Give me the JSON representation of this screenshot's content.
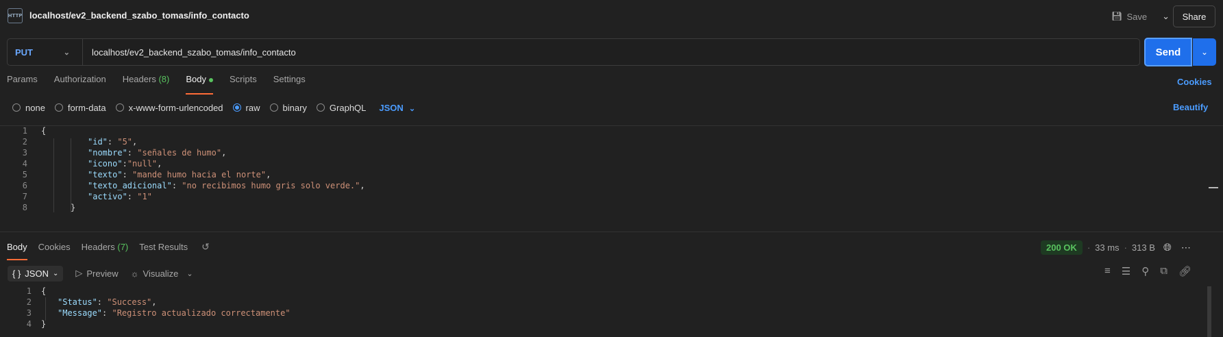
{
  "header": {
    "request_icon": "http-request-icon",
    "title": "localhost/ev2_backend_szabo_tomas/info_contacto",
    "save_label": "Save",
    "share_label": "Share"
  },
  "request": {
    "method": "PUT",
    "url": "localhost/ev2_backend_szabo_tomas/info_contacto",
    "send_label": "Send"
  },
  "request_tabs": [
    {
      "label": "Params"
    },
    {
      "label": "Authorization"
    },
    {
      "label": "Headers",
      "count": "(8)"
    },
    {
      "label": "Body"
    },
    {
      "label": "Scripts"
    },
    {
      "label": "Settings"
    }
  ],
  "cookies_label": "Cookies",
  "body_types": [
    "none",
    "form-data",
    "x-www-form-urlencoded",
    "raw",
    "binary",
    "GraphQL"
  ],
  "selected_body_type": "raw",
  "language": "JSON",
  "beautify_label": "Beautify",
  "request_body_lines": [
    {
      "n": "1",
      "text": "{"
    },
    {
      "n": "2",
      "key": "\"id\"",
      "sep": ": ",
      "val": "\"5\"",
      "end": ","
    },
    {
      "n": "3",
      "key": "\"nombre\"",
      "sep": ": ",
      "val": "\"señales de humo\"",
      "end": ","
    },
    {
      "n": "4",
      "key": "\"icono\"",
      "sep": ":",
      "val": "\"null\"",
      "end": ","
    },
    {
      "n": "5",
      "key": "\"texto\"",
      "sep": ": ",
      "val": "\"mande humo hacia el norte\"",
      "end": ","
    },
    {
      "n": "6",
      "key": "\"texto_adicional\"",
      "sep": ": ",
      "val": "\"no recibimos humo gris solo verde.\"",
      "end": ","
    },
    {
      "n": "7",
      "key": "\"activo\"",
      "sep": ": ",
      "val": "\"1\"",
      "end": ""
    },
    {
      "n": "8",
      "text": "}"
    }
  ],
  "response_tabs": [
    {
      "label": "Body"
    },
    {
      "label": "Cookies"
    },
    {
      "label": "Headers",
      "count": "(7)"
    },
    {
      "label": "Test Results"
    }
  ],
  "response_meta": {
    "status": "200 OK",
    "time": "33 ms",
    "size": "313 B"
  },
  "response_toolbar": {
    "format": "JSON",
    "preview": "Preview",
    "visualize": "Visualize"
  },
  "response_body_lines": [
    {
      "n": "1",
      "text": "{"
    },
    {
      "n": "2",
      "key": "\"Status\"",
      "sep": ": ",
      "val": "\"Success\"",
      "end": ","
    },
    {
      "n": "3",
      "key": "\"Message\"",
      "sep": ": ",
      "val": "\"Registro actualizado correctamente\"",
      "end": ""
    },
    {
      "n": "4",
      "text": "}"
    }
  ],
  "colors": {
    "accent": "#1f6feb",
    "link": "#4b9cff",
    "active_tab_underline": "#ff6c37",
    "success": "#59c35f"
  }
}
